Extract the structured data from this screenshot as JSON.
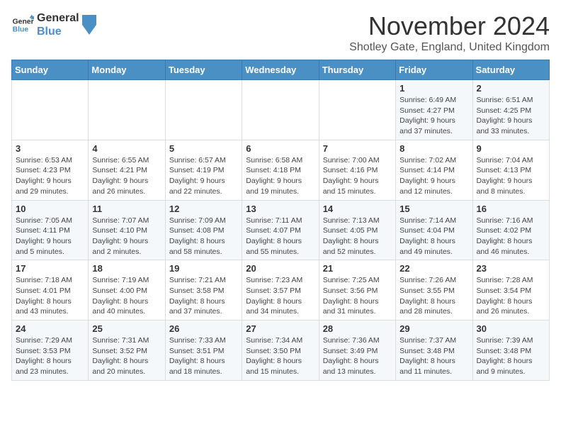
{
  "logo": {
    "line1": "General",
    "line2": "Blue"
  },
  "title": "November 2024",
  "subtitle": "Shotley Gate, England, United Kingdom",
  "weekdays": [
    "Sunday",
    "Monday",
    "Tuesday",
    "Wednesday",
    "Thursday",
    "Friday",
    "Saturday"
  ],
  "weeks": [
    [
      {
        "day": "",
        "info": ""
      },
      {
        "day": "",
        "info": ""
      },
      {
        "day": "",
        "info": ""
      },
      {
        "day": "",
        "info": ""
      },
      {
        "day": "",
        "info": ""
      },
      {
        "day": "1",
        "info": "Sunrise: 6:49 AM\nSunset: 4:27 PM\nDaylight: 9 hours\nand 37 minutes."
      },
      {
        "day": "2",
        "info": "Sunrise: 6:51 AM\nSunset: 4:25 PM\nDaylight: 9 hours\nand 33 minutes."
      }
    ],
    [
      {
        "day": "3",
        "info": "Sunrise: 6:53 AM\nSunset: 4:23 PM\nDaylight: 9 hours\nand 29 minutes."
      },
      {
        "day": "4",
        "info": "Sunrise: 6:55 AM\nSunset: 4:21 PM\nDaylight: 9 hours\nand 26 minutes."
      },
      {
        "day": "5",
        "info": "Sunrise: 6:57 AM\nSunset: 4:19 PM\nDaylight: 9 hours\nand 22 minutes."
      },
      {
        "day": "6",
        "info": "Sunrise: 6:58 AM\nSunset: 4:18 PM\nDaylight: 9 hours\nand 19 minutes."
      },
      {
        "day": "7",
        "info": "Sunrise: 7:00 AM\nSunset: 4:16 PM\nDaylight: 9 hours\nand 15 minutes."
      },
      {
        "day": "8",
        "info": "Sunrise: 7:02 AM\nSunset: 4:14 PM\nDaylight: 9 hours\nand 12 minutes."
      },
      {
        "day": "9",
        "info": "Sunrise: 7:04 AM\nSunset: 4:13 PM\nDaylight: 9 hours\nand 8 minutes."
      }
    ],
    [
      {
        "day": "10",
        "info": "Sunrise: 7:05 AM\nSunset: 4:11 PM\nDaylight: 9 hours\nand 5 minutes."
      },
      {
        "day": "11",
        "info": "Sunrise: 7:07 AM\nSunset: 4:10 PM\nDaylight: 9 hours\nand 2 minutes."
      },
      {
        "day": "12",
        "info": "Sunrise: 7:09 AM\nSunset: 4:08 PM\nDaylight: 8 hours\nand 58 minutes."
      },
      {
        "day": "13",
        "info": "Sunrise: 7:11 AM\nSunset: 4:07 PM\nDaylight: 8 hours\nand 55 minutes."
      },
      {
        "day": "14",
        "info": "Sunrise: 7:13 AM\nSunset: 4:05 PM\nDaylight: 8 hours\nand 52 minutes."
      },
      {
        "day": "15",
        "info": "Sunrise: 7:14 AM\nSunset: 4:04 PM\nDaylight: 8 hours\nand 49 minutes."
      },
      {
        "day": "16",
        "info": "Sunrise: 7:16 AM\nSunset: 4:02 PM\nDaylight: 8 hours\nand 46 minutes."
      }
    ],
    [
      {
        "day": "17",
        "info": "Sunrise: 7:18 AM\nSunset: 4:01 PM\nDaylight: 8 hours\nand 43 minutes."
      },
      {
        "day": "18",
        "info": "Sunrise: 7:19 AM\nSunset: 4:00 PM\nDaylight: 8 hours\nand 40 minutes."
      },
      {
        "day": "19",
        "info": "Sunrise: 7:21 AM\nSunset: 3:58 PM\nDaylight: 8 hours\nand 37 minutes."
      },
      {
        "day": "20",
        "info": "Sunrise: 7:23 AM\nSunset: 3:57 PM\nDaylight: 8 hours\nand 34 minutes."
      },
      {
        "day": "21",
        "info": "Sunrise: 7:25 AM\nSunset: 3:56 PM\nDaylight: 8 hours\nand 31 minutes."
      },
      {
        "day": "22",
        "info": "Sunrise: 7:26 AM\nSunset: 3:55 PM\nDaylight: 8 hours\nand 28 minutes."
      },
      {
        "day": "23",
        "info": "Sunrise: 7:28 AM\nSunset: 3:54 PM\nDaylight: 8 hours\nand 26 minutes."
      }
    ],
    [
      {
        "day": "24",
        "info": "Sunrise: 7:29 AM\nSunset: 3:53 PM\nDaylight: 8 hours\nand 23 minutes."
      },
      {
        "day": "25",
        "info": "Sunrise: 7:31 AM\nSunset: 3:52 PM\nDaylight: 8 hours\nand 20 minutes."
      },
      {
        "day": "26",
        "info": "Sunrise: 7:33 AM\nSunset: 3:51 PM\nDaylight: 8 hours\nand 18 minutes."
      },
      {
        "day": "27",
        "info": "Sunrise: 7:34 AM\nSunset: 3:50 PM\nDaylight: 8 hours\nand 15 minutes."
      },
      {
        "day": "28",
        "info": "Sunrise: 7:36 AM\nSunset: 3:49 PM\nDaylight: 8 hours\nand 13 minutes."
      },
      {
        "day": "29",
        "info": "Sunrise: 7:37 AM\nSunset: 3:48 PM\nDaylight: 8 hours\nand 11 minutes."
      },
      {
        "day": "30",
        "info": "Sunrise: 7:39 AM\nSunset: 3:48 PM\nDaylight: 8 hours\nand 9 minutes."
      }
    ]
  ]
}
